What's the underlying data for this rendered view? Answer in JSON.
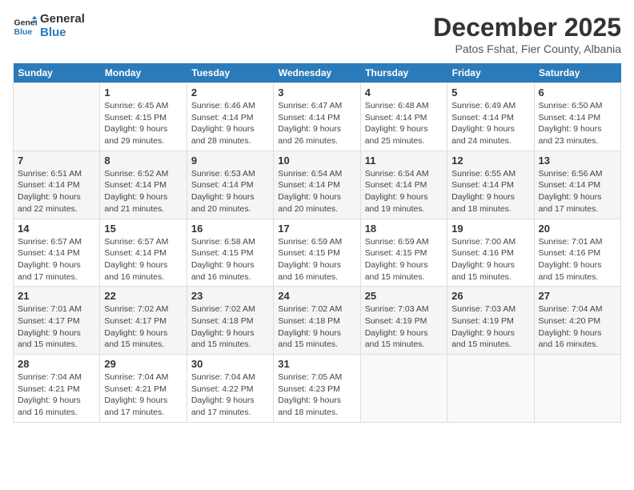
{
  "logo": {
    "general": "General",
    "blue": "Blue"
  },
  "header": {
    "month": "December 2025",
    "location": "Patos Fshat, Fier County, Albania"
  },
  "days_of_week": [
    "Sunday",
    "Monday",
    "Tuesday",
    "Wednesday",
    "Thursday",
    "Friday",
    "Saturday"
  ],
  "weeks": [
    [
      {
        "day": "",
        "sunrise": "",
        "sunset": "",
        "daylight": ""
      },
      {
        "day": "1",
        "sunrise": "Sunrise: 6:45 AM",
        "sunset": "Sunset: 4:15 PM",
        "daylight": "Daylight: 9 hours and 29 minutes."
      },
      {
        "day": "2",
        "sunrise": "Sunrise: 6:46 AM",
        "sunset": "Sunset: 4:14 PM",
        "daylight": "Daylight: 9 hours and 28 minutes."
      },
      {
        "day": "3",
        "sunrise": "Sunrise: 6:47 AM",
        "sunset": "Sunset: 4:14 PM",
        "daylight": "Daylight: 9 hours and 26 minutes."
      },
      {
        "day": "4",
        "sunrise": "Sunrise: 6:48 AM",
        "sunset": "Sunset: 4:14 PM",
        "daylight": "Daylight: 9 hours and 25 minutes."
      },
      {
        "day": "5",
        "sunrise": "Sunrise: 6:49 AM",
        "sunset": "Sunset: 4:14 PM",
        "daylight": "Daylight: 9 hours and 24 minutes."
      },
      {
        "day": "6",
        "sunrise": "Sunrise: 6:50 AM",
        "sunset": "Sunset: 4:14 PM",
        "daylight": "Daylight: 9 hours and 23 minutes."
      }
    ],
    [
      {
        "day": "7",
        "sunrise": "Sunrise: 6:51 AM",
        "sunset": "Sunset: 4:14 PM",
        "daylight": "Daylight: 9 hours and 22 minutes."
      },
      {
        "day": "8",
        "sunrise": "Sunrise: 6:52 AM",
        "sunset": "Sunset: 4:14 PM",
        "daylight": "Daylight: 9 hours and 21 minutes."
      },
      {
        "day": "9",
        "sunrise": "Sunrise: 6:53 AM",
        "sunset": "Sunset: 4:14 PM",
        "daylight": "Daylight: 9 hours and 20 minutes."
      },
      {
        "day": "10",
        "sunrise": "Sunrise: 6:54 AM",
        "sunset": "Sunset: 4:14 PM",
        "daylight": "Daylight: 9 hours and 20 minutes."
      },
      {
        "day": "11",
        "sunrise": "Sunrise: 6:54 AM",
        "sunset": "Sunset: 4:14 PM",
        "daylight": "Daylight: 9 hours and 19 minutes."
      },
      {
        "day": "12",
        "sunrise": "Sunrise: 6:55 AM",
        "sunset": "Sunset: 4:14 PM",
        "daylight": "Daylight: 9 hours and 18 minutes."
      },
      {
        "day": "13",
        "sunrise": "Sunrise: 6:56 AM",
        "sunset": "Sunset: 4:14 PM",
        "daylight": "Daylight: 9 hours and 17 minutes."
      }
    ],
    [
      {
        "day": "14",
        "sunrise": "Sunrise: 6:57 AM",
        "sunset": "Sunset: 4:14 PM",
        "daylight": "Daylight: 9 hours and 17 minutes."
      },
      {
        "day": "15",
        "sunrise": "Sunrise: 6:57 AM",
        "sunset": "Sunset: 4:14 PM",
        "daylight": "Daylight: 9 hours and 16 minutes."
      },
      {
        "day": "16",
        "sunrise": "Sunrise: 6:58 AM",
        "sunset": "Sunset: 4:15 PM",
        "daylight": "Daylight: 9 hours and 16 minutes."
      },
      {
        "day": "17",
        "sunrise": "Sunrise: 6:59 AM",
        "sunset": "Sunset: 4:15 PM",
        "daylight": "Daylight: 9 hours and 16 minutes."
      },
      {
        "day": "18",
        "sunrise": "Sunrise: 6:59 AM",
        "sunset": "Sunset: 4:15 PM",
        "daylight": "Daylight: 9 hours and 15 minutes."
      },
      {
        "day": "19",
        "sunrise": "Sunrise: 7:00 AM",
        "sunset": "Sunset: 4:16 PM",
        "daylight": "Daylight: 9 hours and 15 minutes."
      },
      {
        "day": "20",
        "sunrise": "Sunrise: 7:01 AM",
        "sunset": "Sunset: 4:16 PM",
        "daylight": "Daylight: 9 hours and 15 minutes."
      }
    ],
    [
      {
        "day": "21",
        "sunrise": "Sunrise: 7:01 AM",
        "sunset": "Sunset: 4:17 PM",
        "daylight": "Daylight: 9 hours and 15 minutes."
      },
      {
        "day": "22",
        "sunrise": "Sunrise: 7:02 AM",
        "sunset": "Sunset: 4:17 PM",
        "daylight": "Daylight: 9 hours and 15 minutes."
      },
      {
        "day": "23",
        "sunrise": "Sunrise: 7:02 AM",
        "sunset": "Sunset: 4:18 PM",
        "daylight": "Daylight: 9 hours and 15 minutes."
      },
      {
        "day": "24",
        "sunrise": "Sunrise: 7:02 AM",
        "sunset": "Sunset: 4:18 PM",
        "daylight": "Daylight: 9 hours and 15 minutes."
      },
      {
        "day": "25",
        "sunrise": "Sunrise: 7:03 AM",
        "sunset": "Sunset: 4:19 PM",
        "daylight": "Daylight: 9 hours and 15 minutes."
      },
      {
        "day": "26",
        "sunrise": "Sunrise: 7:03 AM",
        "sunset": "Sunset: 4:19 PM",
        "daylight": "Daylight: 9 hours and 15 minutes."
      },
      {
        "day": "27",
        "sunrise": "Sunrise: 7:04 AM",
        "sunset": "Sunset: 4:20 PM",
        "daylight": "Daylight: 9 hours and 16 minutes."
      }
    ],
    [
      {
        "day": "28",
        "sunrise": "Sunrise: 7:04 AM",
        "sunset": "Sunset: 4:21 PM",
        "daylight": "Daylight: 9 hours and 16 minutes."
      },
      {
        "day": "29",
        "sunrise": "Sunrise: 7:04 AM",
        "sunset": "Sunset: 4:21 PM",
        "daylight": "Daylight: 9 hours and 17 minutes."
      },
      {
        "day": "30",
        "sunrise": "Sunrise: 7:04 AM",
        "sunset": "Sunset: 4:22 PM",
        "daylight": "Daylight: 9 hours and 17 minutes."
      },
      {
        "day": "31",
        "sunrise": "Sunrise: 7:05 AM",
        "sunset": "Sunset: 4:23 PM",
        "daylight": "Daylight: 9 hours and 18 minutes."
      },
      {
        "day": "",
        "sunrise": "",
        "sunset": "",
        "daylight": ""
      },
      {
        "day": "",
        "sunrise": "",
        "sunset": "",
        "daylight": ""
      },
      {
        "day": "",
        "sunrise": "",
        "sunset": "",
        "daylight": ""
      }
    ]
  ]
}
